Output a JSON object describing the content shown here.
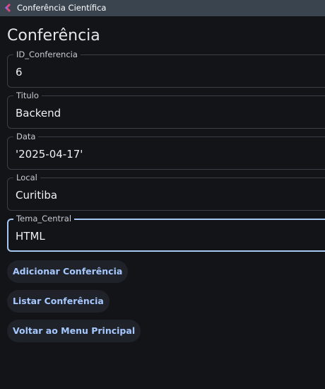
{
  "window": {
    "title": "Conferência Científica",
    "icon": "app-logo-icon"
  },
  "page": {
    "title": "Conferência"
  },
  "form": {
    "fields": [
      {
        "label": "ID_Conferencia",
        "value": "6"
      },
      {
        "label": "Titulo",
        "value": "Backend"
      },
      {
        "label": "Data",
        "value": "'2025-04-17'"
      },
      {
        "label": "Local",
        "value": "Curitiba"
      },
      {
        "label": "Tema_Central",
        "value": "HTML",
        "focused": true
      }
    ]
  },
  "buttons": {
    "add": "Adicionar Conferência",
    "list": "Listar Conferência",
    "back": "Voltar ao Menu Principal"
  },
  "colors": {
    "background": "#121418",
    "titlebar": "#39444f",
    "accent": "#a6c8ff",
    "focus_border": "#a8c8f4",
    "field_border": "#3a3f47",
    "button_bg": "#1f2329"
  }
}
